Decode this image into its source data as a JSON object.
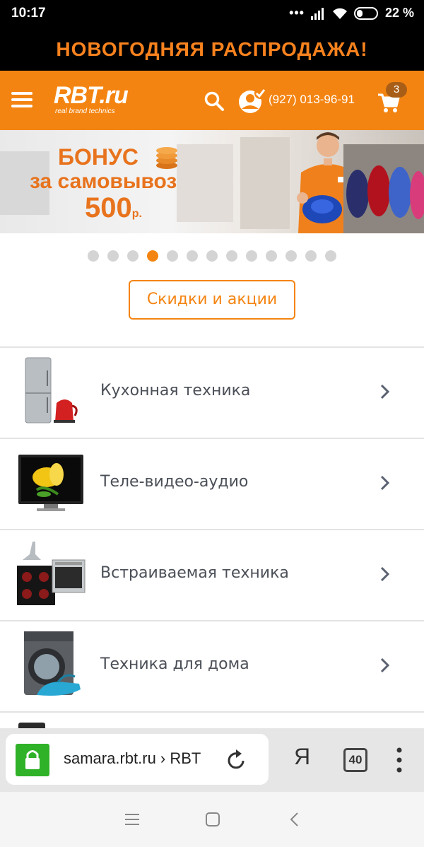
{
  "status_bar": {
    "time": "10:17",
    "battery_percent": "22 %",
    "dots": "•••"
  },
  "promo": {
    "text": "НОВОГОДНЯЯ РАСПРОДАЖА!"
  },
  "header": {
    "logo_main": "RBT.ru",
    "logo_tagline": "real brand technics",
    "phone": "(927) 013-96-91",
    "cart_count": "3",
    "accent_color": "#f48411"
  },
  "banner": {
    "line1": "БОНУС",
    "line2": "за самовывоз",
    "amount": "500",
    "currency": "р."
  },
  "carousel": {
    "total": 13,
    "active_index": 3
  },
  "discounts_button": {
    "label": "Скидки и акции"
  },
  "categories": [
    {
      "label": "Кухонная техника",
      "icon": "fridge-kettle-image"
    },
    {
      "label": "Теле-видео-аудио",
      "icon": "tv-image"
    },
    {
      "label": "Встраиваемая техника",
      "icon": "built-in-appliances-image"
    },
    {
      "label": "Техника для дома",
      "icon": "washer-iron-image"
    }
  ],
  "browser": {
    "url": "samara.rbt.ru › RBT",
    "yandex_label": "Я",
    "tab_count": "40"
  }
}
